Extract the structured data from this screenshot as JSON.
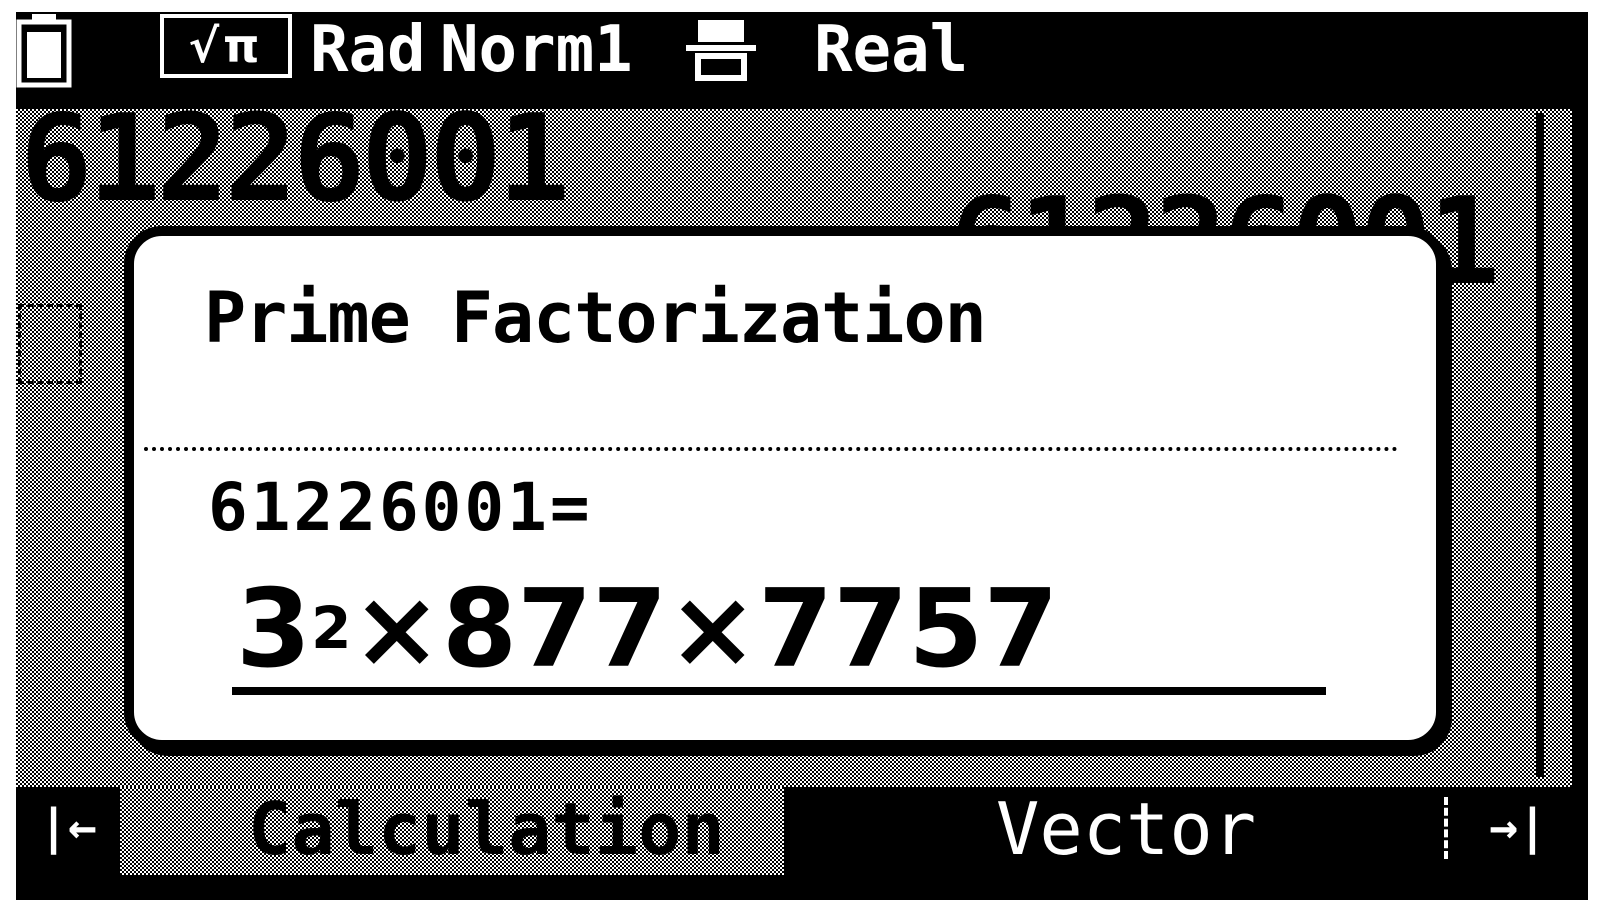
{
  "status_bar": {
    "battery_icon": "battery-icon",
    "math_mode": "√π",
    "angle_unit": "Rad",
    "display_format": "Norm1",
    "input_icon": "input-output-icon",
    "complex_mode": "Real"
  },
  "calc_area": {
    "background_expression": "61226001",
    "background_result": "61226001"
  },
  "dialog": {
    "title": "Prime Factorization",
    "expression": "61226001=",
    "answer_base": "3",
    "answer_exponent": "2",
    "answer_rest": "×877×7757"
  },
  "tabs": {
    "prev_symbol": "|←",
    "items": [
      {
        "label": "Calculation",
        "active": true
      },
      {
        "label": "Vector",
        "active": false
      }
    ],
    "next_symbol": "→|"
  },
  "colors": {
    "foreground": "#000000",
    "background": "#ffffff"
  }
}
